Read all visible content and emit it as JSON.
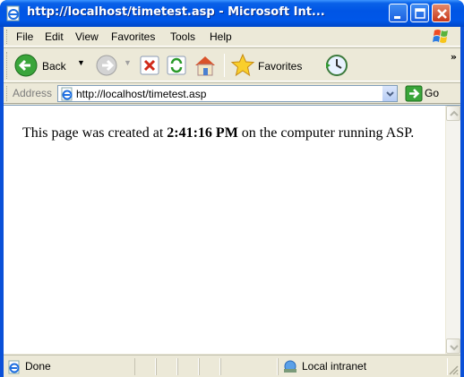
{
  "window": {
    "title": "http://localhost/timetest.asp - Microsoft Int..."
  },
  "menu": {
    "items": [
      "File",
      "Edit",
      "View",
      "Favorites",
      "Tools",
      "Help"
    ]
  },
  "toolbar": {
    "back_label": "Back",
    "favorites_label": "Favorites",
    "overflow": "»"
  },
  "address": {
    "label": "Address",
    "url": "http://localhost/timetest.asp",
    "go_label": "Go"
  },
  "page": {
    "text_before": "This page was created at ",
    "time": "2:41:16 PM",
    "text_after": " on the computer running ASP."
  },
  "status": {
    "left": "Done",
    "zone": "Local intranet"
  },
  "colors": {
    "titlebar": "#0055e5",
    "chrome": "#ece9d8",
    "close_button": "#c8381a"
  },
  "icons": [
    "ie-page-icon",
    "minimize-icon",
    "maximize-icon",
    "close-icon",
    "windows-logo-icon",
    "back-arrow-icon",
    "forward-arrow-icon",
    "stop-icon",
    "refresh-icon",
    "home-icon",
    "favorites-star-icon",
    "history-icon",
    "go-arrow-icon",
    "local-intranet-icon"
  ]
}
